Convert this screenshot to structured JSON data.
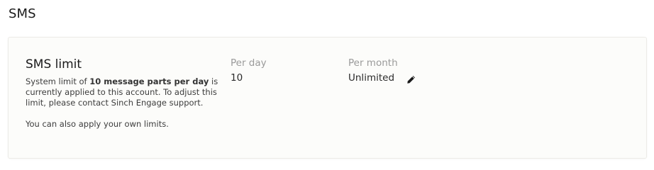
{
  "page": {
    "title": "SMS"
  },
  "sms_limit": {
    "title": "SMS limit",
    "description_prefix": "System limit of ",
    "description_bold": "10 message parts per day",
    "description_suffix": " is currently applied to this account. To adjust this limit, please contact Sinch Engage support.",
    "description_second": "You can also apply your own limits.",
    "per_day_label": "Per day",
    "per_day_value": "10",
    "per_month_label": "Per month",
    "per_month_value": "Unlimited",
    "edit_icon": "pencil-icon"
  }
}
